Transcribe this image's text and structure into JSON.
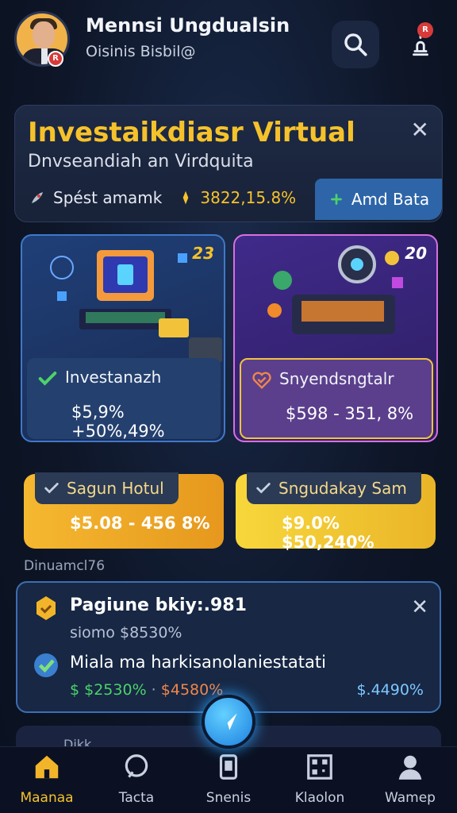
{
  "header": {
    "user_name": "Mennsi Ungdualsin",
    "user_sub": "Oisinis Bisbil@",
    "avatar_badge": "R",
    "bell_badge": "R"
  },
  "banner": {
    "title": "Investaikdiasr Virtual",
    "subtitle": "Dnvseandiah an Virdquita",
    "stat_label": "Spést amamk",
    "stat_amount": "3822,15.8%",
    "action_label": "Amd Bata"
  },
  "cards": [
    {
      "number": "23",
      "name": "Investanazh",
      "value": "$5,9% +50%,49%"
    },
    {
      "number": "20",
      "name": "Snyendsngtalr",
      "value": "$598 - 351, 8%"
    }
  ],
  "gold_cards": [
    {
      "tag": "Sagun Hotul",
      "value": "$5.08 - 456 8%"
    },
    {
      "tag": "Sngudakay Sam",
      "value": "$9.0% $50,240%"
    }
  ],
  "section_label": "Dinuamcl76",
  "notification": {
    "title": "Pagiune bkiy:.981",
    "subtitle": "siomo $8530%",
    "body": "Miala ma harkisanolaniestatati",
    "value_green": "$ $2530%",
    "value_sep": "·",
    "value_orange": "$4580%",
    "value_right": "$.4490%"
  },
  "peek_text": "Dikk",
  "nav": [
    {
      "label": "Maanaa",
      "icon": "home-icon"
    },
    {
      "label": "Tacta",
      "icon": "chat-icon"
    },
    {
      "label": "Snenis",
      "icon": "phone-icon"
    },
    {
      "label": "Klaolon",
      "icon": "qr-icon"
    },
    {
      "label": "Wamep",
      "icon": "user-icon"
    }
  ]
}
